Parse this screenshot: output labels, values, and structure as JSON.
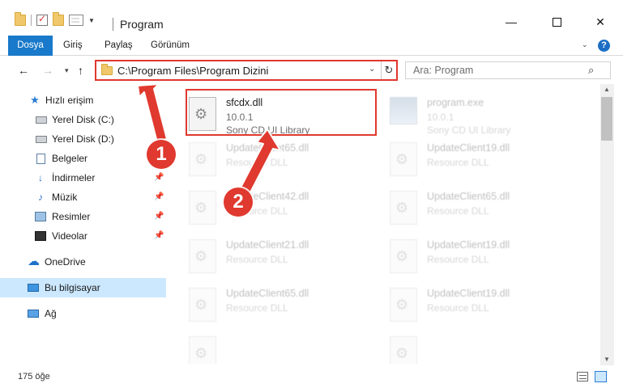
{
  "window": {
    "title": "Program",
    "controls": {
      "minimize": "—",
      "maximize": "",
      "close": "✕"
    }
  },
  "ribbon": {
    "tabs": [
      "Dosya",
      "Giriş",
      "Paylaş",
      "Görünüm"
    ],
    "help": "?"
  },
  "nav": {
    "back": "←",
    "forward": "→",
    "recent": "▾",
    "up": "↑",
    "address": "C:\\Program Files\\Program Dizini",
    "address_dropdown": "⌄",
    "refresh": "↻",
    "search_placeholder": "Ara: Program",
    "search_icon": "⌕"
  },
  "sidebar": {
    "items": [
      {
        "label": "Hızlı erişim",
        "icon": "star-icon"
      },
      {
        "label": "Yerel Disk (C:)",
        "icon": "drive-icon"
      },
      {
        "label": "Yerel Disk (D:)",
        "icon": "drive-icon"
      },
      {
        "label": "Belgeler",
        "icon": "documents-icon"
      },
      {
        "label": "İndirmeler",
        "icon": "downloads-icon",
        "pinned": true
      },
      {
        "label": "Müzik",
        "icon": "music-icon",
        "pinned": true
      },
      {
        "label": "Resimler",
        "icon": "pictures-icon",
        "pinned": true
      },
      {
        "label": "Videolar",
        "icon": "videos-icon",
        "pinned": true
      },
      {
        "label": "OneDrive",
        "icon": "onedrive-icon"
      },
      {
        "label": "Bu bilgisayar",
        "icon": "pc-icon",
        "selected": true
      },
      {
        "label": "Ağ",
        "icon": "network-icon"
      }
    ]
  },
  "files": {
    "highlighted": {
      "name": "sfcdx.dll",
      "version": "10.0.1",
      "description": "Sony CD UI Library"
    },
    "top_right": {
      "name": "program.exe",
      "version": "10.0.1",
      "description": "Sony CD UI Library"
    },
    "faded": [
      {
        "name": "UpdateClient65.dll",
        "description": "Resource DLL"
      },
      {
        "name": "UpdateClient19.dll",
        "description": "Resource DLL"
      },
      {
        "name": "UpdateClient42.dll",
        "description": "Resource DLL"
      },
      {
        "name": "UpdateClient65.dll",
        "description": "Resource DLL"
      },
      {
        "name": "UpdateClient21.dll",
        "description": "Resource DLL"
      },
      {
        "name": "UpdateClient19.dll",
        "description": "Resource DLL"
      },
      {
        "name": "UpdateClient65.dll",
        "description": "Resource DLL"
      },
      {
        "name": "UpdateClient19.dll",
        "description": "Resource DLL"
      }
    ]
  },
  "status": {
    "count": "175 öğe"
  },
  "annotations": {
    "step1": "1",
    "step2": "2",
    "color": "#e0392f"
  }
}
